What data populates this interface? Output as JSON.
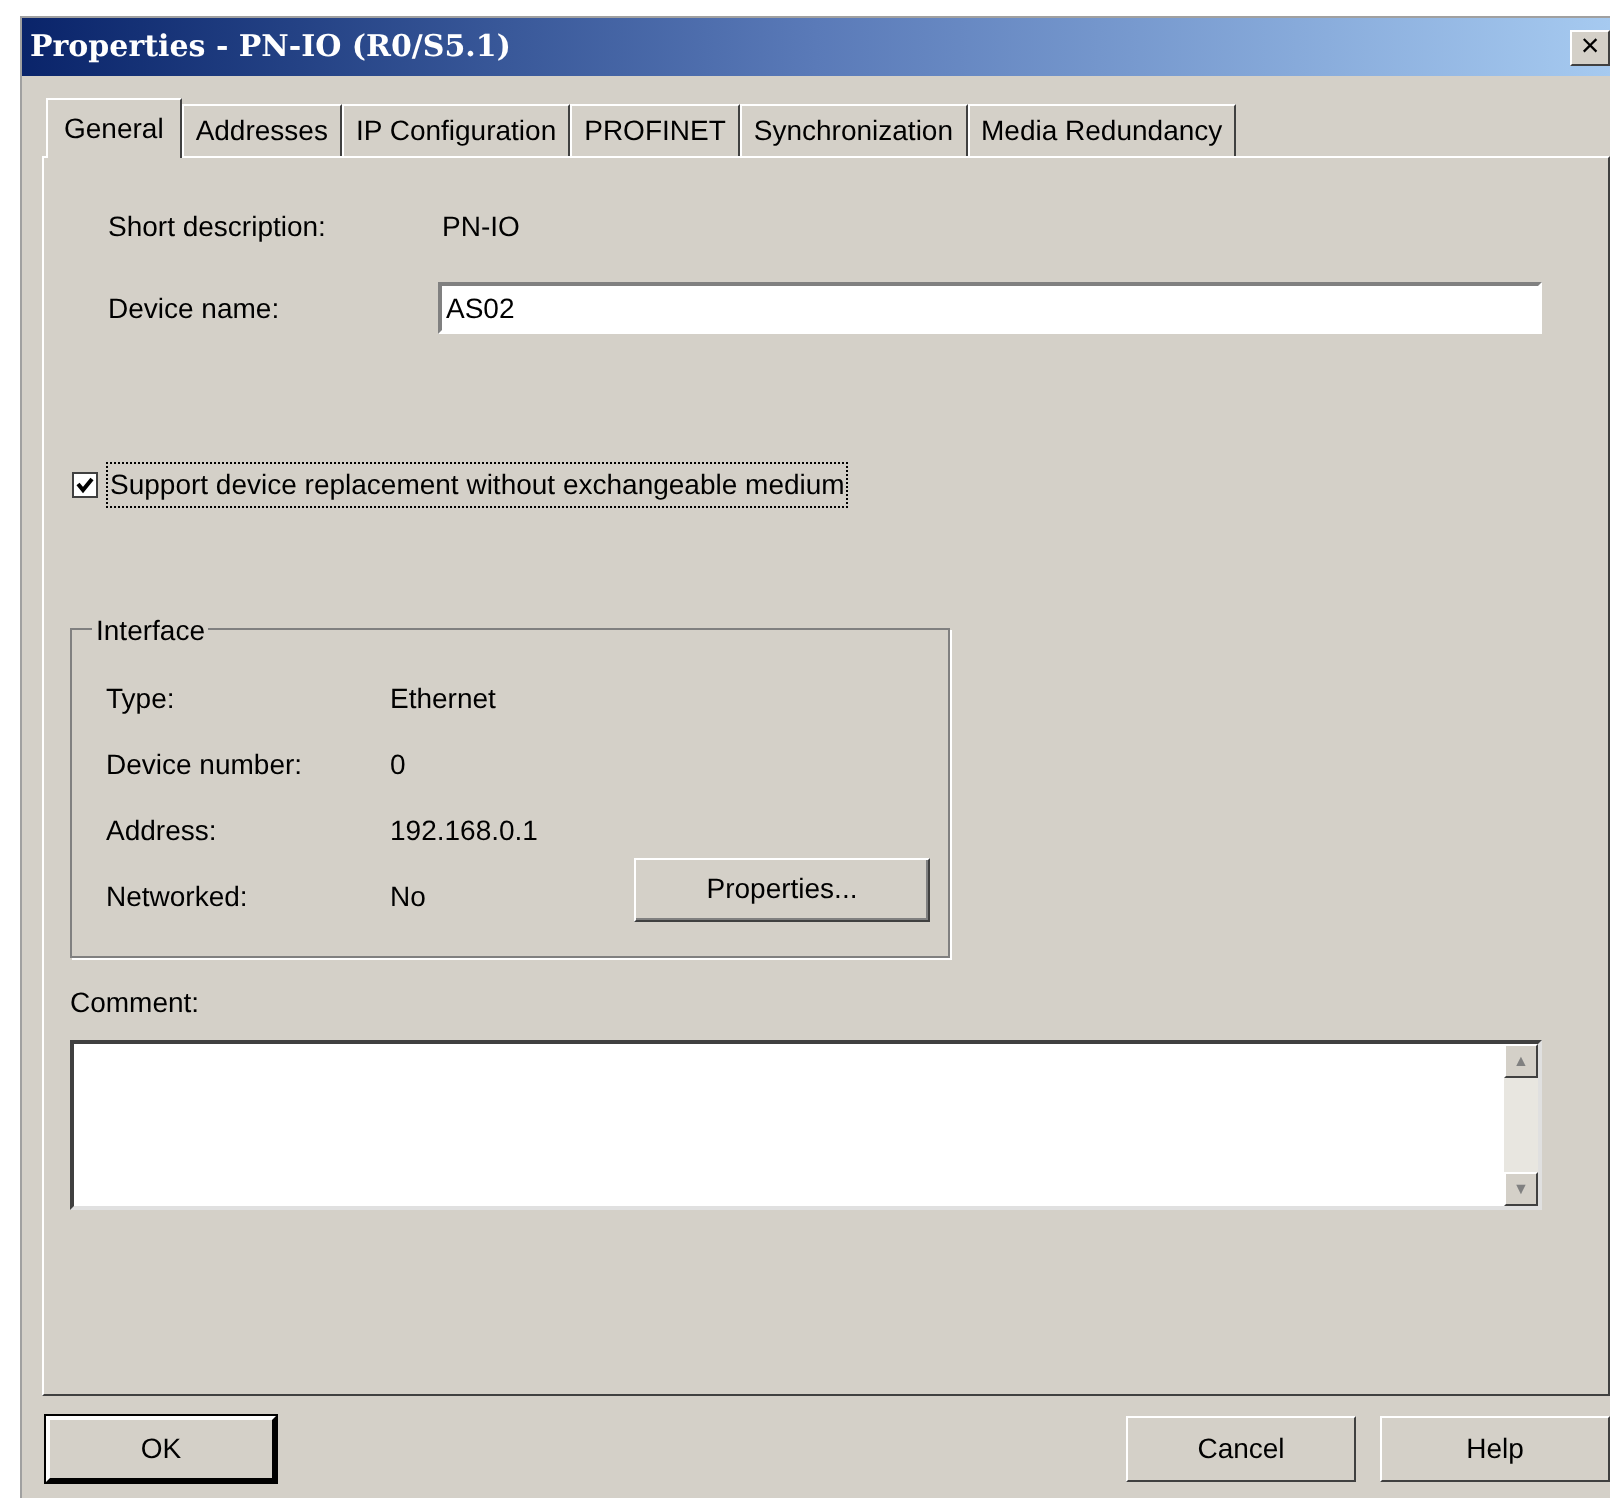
{
  "window": {
    "title": "Properties - PN-IO (R0/S5.1)",
    "close": "×"
  },
  "tabs": [
    {
      "label": "General",
      "selected": true
    },
    {
      "label": "Addresses",
      "selected": false
    },
    {
      "label": "IP Configuration",
      "selected": false
    },
    {
      "label": "PROFINET",
      "selected": false
    },
    {
      "label": "Synchronization",
      "selected": false
    },
    {
      "label": "Media Redundancy",
      "selected": false
    }
  ],
  "short_description": {
    "label": "Short description:",
    "value": "PN-IO"
  },
  "device_name": {
    "label": "Device name:",
    "value": "AS02"
  },
  "replacement_checkbox": {
    "label": "Support device replacement without exchangeable medium",
    "checked": true
  },
  "interface": {
    "title": "Interface",
    "rows": [
      {
        "label": "Type:",
        "value": "Ethernet"
      },
      {
        "label": "Device number:",
        "value": "0"
      },
      {
        "label": "Address:",
        "value": "192.168.0.1"
      },
      {
        "label": "Networked:",
        "value": "No"
      }
    ],
    "button": "Properties..."
  },
  "comment": {
    "label": "Comment:",
    "up": "▲",
    "down": "▼"
  },
  "buttons": {
    "left": [
      "OK"
    ],
    "right": [
      "Cancel",
      "Help"
    ]
  }
}
